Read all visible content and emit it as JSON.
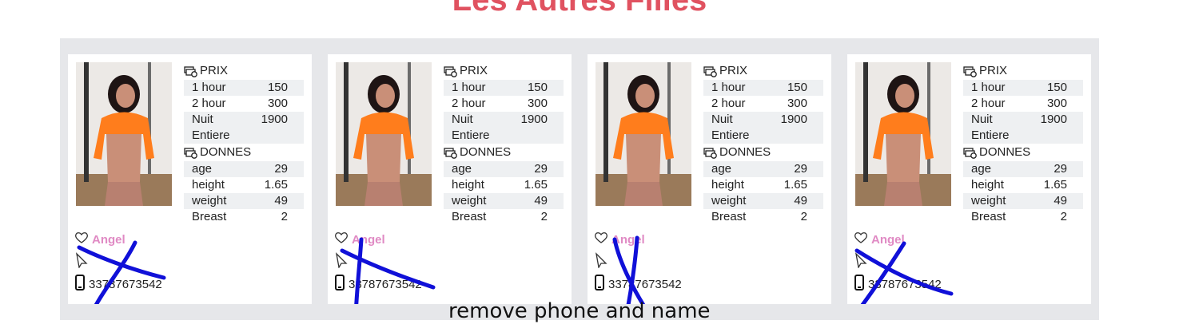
{
  "page": {
    "title": "Les Autres Filles",
    "annotation": "remove phone and name"
  },
  "colors": {
    "title": "#e05260",
    "name": "#e08ac4",
    "band": "#e6e7ea",
    "scribble": "#1010d8"
  },
  "cards": [
    {
      "prix_label": "PRIX",
      "prices": [
        {
          "label": "1 hour",
          "value": "150"
        },
        {
          "label": "2 hour",
          "value": "300"
        },
        {
          "label": "Nuit Entiere",
          "value": "1900"
        }
      ],
      "donnes_label": "DONNES",
      "stats": [
        {
          "label": "age",
          "value": "29"
        },
        {
          "label": "height",
          "value": "1.65"
        },
        {
          "label": "weight",
          "value": "49"
        },
        {
          "label": "Breast",
          "value": "2"
        }
      ],
      "name": "Angel",
      "phone": "33787673542",
      "icons": [
        "heart-icon",
        "cursor-arrow-icon",
        "phone-icon",
        "money-icon"
      ]
    },
    {
      "prix_label": "PRIX",
      "prices": [
        {
          "label": "1 hour",
          "value": "150"
        },
        {
          "label": "2 hour",
          "value": "300"
        },
        {
          "label": "Nuit Entiere",
          "value": "1900"
        }
      ],
      "donnes_label": "DONNES",
      "stats": [
        {
          "label": "age",
          "value": "29"
        },
        {
          "label": "height",
          "value": "1.65"
        },
        {
          "label": "weight",
          "value": "49"
        },
        {
          "label": "Breast",
          "value": "2"
        }
      ],
      "name": "Angel",
      "phone": "33787673542",
      "icons": [
        "heart-icon",
        "cursor-arrow-icon",
        "phone-icon",
        "money-icon"
      ]
    },
    {
      "prix_label": "PRIX",
      "prices": [
        {
          "label": "1 hour",
          "value": "150"
        },
        {
          "label": "2 hour",
          "value": "300"
        },
        {
          "label": "Nuit Entiere",
          "value": "1900"
        }
      ],
      "donnes_label": "DONNES",
      "stats": [
        {
          "label": "age",
          "value": "29"
        },
        {
          "label": "height",
          "value": "1.65"
        },
        {
          "label": "weight",
          "value": "49"
        },
        {
          "label": "Breast",
          "value": "2"
        }
      ],
      "name": "Angel",
      "phone": "33787673542",
      "icons": [
        "heart-icon",
        "cursor-arrow-icon",
        "phone-icon",
        "money-icon"
      ]
    },
    {
      "prix_label": "PRIX",
      "prices": [
        {
          "label": "1 hour",
          "value": "150"
        },
        {
          "label": "2 hour",
          "value": "300"
        },
        {
          "label": "Nuit Entiere",
          "value": "1900"
        }
      ],
      "donnes_label": "DONNES",
      "stats": [
        {
          "label": "age",
          "value": "29"
        },
        {
          "label": "height",
          "value": "1.65"
        },
        {
          "label": "weight",
          "value": "49"
        },
        {
          "label": "Breast",
          "value": "2"
        }
      ],
      "name": "Angel",
      "phone": "33787673542",
      "icons": [
        "heart-icon",
        "cursor-arrow-icon",
        "phone-icon",
        "money-icon"
      ]
    }
  ]
}
